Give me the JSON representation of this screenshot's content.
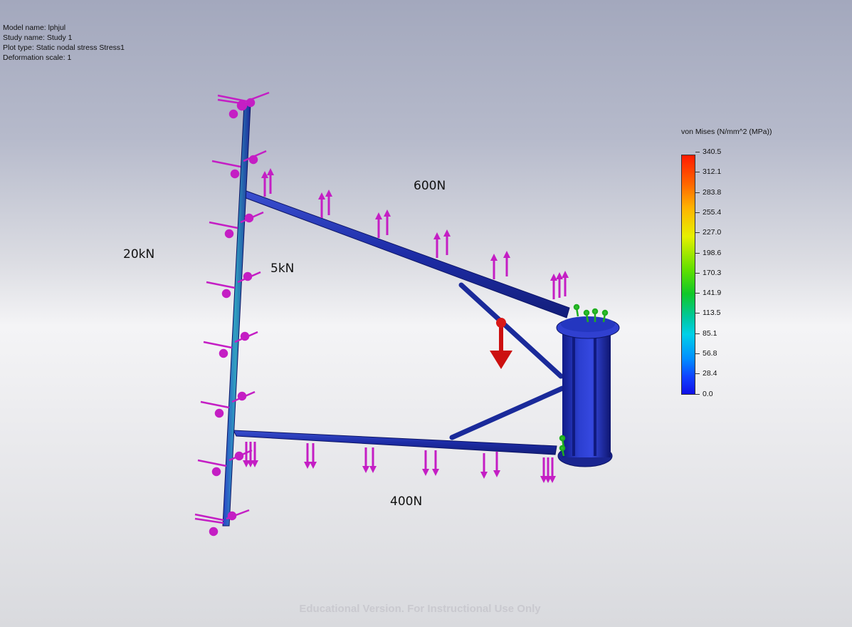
{
  "info": {
    "model_name": "Model name: lphjul",
    "study_name": "Study name: Study 1",
    "plot_type": "Plot type: Static nodal stress Stress1",
    "deformation_scale": "Deformation scale: 1"
  },
  "labels": {
    "load_600": "600N",
    "load_20k": "20kN",
    "load_5k": "5kN",
    "load_400": "400N"
  },
  "legend": {
    "title": "von Mises (N/mm^2 (MPa))",
    "ticks": [
      "340.5",
      "312.1",
      "283.8",
      "255.4",
      "227.0",
      "198.6",
      "170.3",
      "141.9",
      "113.5",
      "85.1",
      "56.8",
      "28.4",
      "0.0"
    ]
  },
  "watermark": "Educational Version. For Instructional Use Only",
  "colors": {
    "beam": "#1f2fa8",
    "load_arrow": "#c81ec8",
    "fixture": "#22b022",
    "gravity": "#cc1010"
  }
}
